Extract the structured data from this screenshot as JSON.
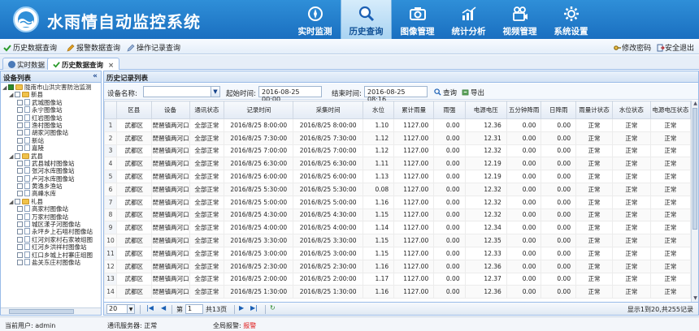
{
  "app": {
    "title": "水雨情自动监控系统"
  },
  "nav": [
    {
      "label": "实时监测",
      "icon": "compass-icon"
    },
    {
      "label": "历史查询",
      "icon": "magnifier-icon",
      "active": true
    },
    {
      "label": "图像管理",
      "icon": "camera-icon"
    },
    {
      "label": "统计分析",
      "icon": "bar-chart-icon"
    },
    {
      "label": "视频管理",
      "icon": "video-icon"
    },
    {
      "label": "系统设置",
      "icon": "gear-icon"
    }
  ],
  "toolbar": {
    "history_query": "历史数据查询",
    "alarm_query": "报警数据查询",
    "operation_query": "操作记录查询",
    "change_password": "修改密码",
    "safe_exit": "安全退出"
  },
  "tabs": [
    {
      "label": "实时数据"
    },
    {
      "label": "历史数据查询",
      "active": true,
      "closable": "×"
    }
  ],
  "sidebar": {
    "title": "设备列表",
    "collapse": "«",
    "tree": [
      {
        "level": 0,
        "type": "root",
        "label": "陇南市山洪灾害防治监测"
      },
      {
        "level": 1,
        "type": "folder",
        "label": "新县"
      },
      {
        "level": 2,
        "type": "leaf",
        "label": "武城图像站"
      },
      {
        "level": 2,
        "type": "leaf",
        "label": "永宁图像站"
      },
      {
        "level": 2,
        "type": "leaf",
        "label": "红岩图像站"
      },
      {
        "level": 2,
        "type": "leaf",
        "label": "渔村图像站"
      },
      {
        "level": 2,
        "type": "leaf",
        "label": "胡家河图像站"
      },
      {
        "level": 2,
        "type": "leaf",
        "label": "新站"
      },
      {
        "level": 2,
        "type": "leaf",
        "label": "嘉陵"
      },
      {
        "level": 1,
        "type": "folder",
        "label": "武县"
      },
      {
        "level": 2,
        "type": "leaf",
        "label": "武县城村图像站"
      },
      {
        "level": 2,
        "type": "leaf",
        "label": "张河水库图像站"
      },
      {
        "level": 2,
        "type": "leaf",
        "label": "卢河水库图像站"
      },
      {
        "level": 2,
        "type": "leaf",
        "label": "黄逸乡渔站"
      },
      {
        "level": 2,
        "type": "leaf",
        "label": "高峰水库"
      },
      {
        "level": 1,
        "type": "folder",
        "label": "礼县"
      },
      {
        "level": 2,
        "type": "leaf",
        "label": "高家村图像站"
      },
      {
        "level": 2,
        "type": "leaf",
        "label": "万家村图像站"
      },
      {
        "level": 2,
        "type": "leaf",
        "label": "城区漾子河图像站"
      },
      {
        "level": 2,
        "type": "leaf",
        "label": "永坪乡上石咀村图像站"
      },
      {
        "level": 2,
        "type": "leaf",
        "label": "红河刘家村石家坡组图"
      },
      {
        "level": 2,
        "type": "leaf",
        "label": "红河乡洪祥村图像站"
      },
      {
        "level": 2,
        "type": "leaf",
        "label": "红口乡城上村寨庄组图"
      },
      {
        "level": 2,
        "type": "leaf",
        "label": "盐关东庄村图像站"
      }
    ]
  },
  "records": {
    "title": "历史记录列表",
    "device_label": "设备名称:",
    "device_value": "",
    "start_label": "起始时间:",
    "start_value": "2016-08-25 00:00",
    "end_label": "结束时间:",
    "end_value": "2016-08-25 08:16",
    "query_label": "查询",
    "export_label": "导出",
    "columns": [
      "",
      "区县",
      "设备",
      "通讯状态",
      "记录时间",
      "采集时间",
      "水位",
      "累计雨量",
      "雨强",
      "电源电压",
      "五分钟降雨",
      "日降雨",
      "雨量计状态",
      "水位状态",
      "电源电压状态"
    ],
    "rows": [
      [
        "1",
        "武都区",
        "琵琶镇两河口",
        "全部正常",
        "2016/8/25 8:00:00",
        "2016/8/25 8:00:00",
        "1.10",
        "1127.00",
        "0.00",
        "12.36",
        "0.00",
        "0.00",
        "正常",
        "正常",
        "正常"
      ],
      [
        "2",
        "武都区",
        "琵琶镇两河口",
        "全部正常",
        "2016/8/25 7:30:00",
        "2016/8/25 7:30:00",
        "1.12",
        "1127.00",
        "0.00",
        "12.31",
        "0.00",
        "0.00",
        "正常",
        "正常",
        "正常"
      ],
      [
        "3",
        "武都区",
        "琵琶镇两河口",
        "全部正常",
        "2016/8/25 7:00:00",
        "2016/8/25 7:00:00",
        "1.12",
        "1127.00",
        "0.00",
        "12.32",
        "0.00",
        "0.00",
        "正常",
        "正常",
        "正常"
      ],
      [
        "4",
        "武都区",
        "琵琶镇两河口",
        "全部正常",
        "2016/8/25 6:30:00",
        "2016/8/25 6:30:00",
        "1.11",
        "1127.00",
        "0.00",
        "12.19",
        "0.00",
        "0.00",
        "正常",
        "正常",
        "正常"
      ],
      [
        "5",
        "武都区",
        "琵琶镇两河口",
        "全部正常",
        "2016/8/25 6:00:00",
        "2016/8/25 6:00:00",
        "1.13",
        "1127.00",
        "0.00",
        "12.19",
        "0.00",
        "0.00",
        "正常",
        "正常",
        "正常"
      ],
      [
        "6",
        "武都区",
        "琵琶镇两河口",
        "全部正常",
        "2016/8/25 5:30:00",
        "2016/8/25 5:30:00",
        "0.08",
        "1127.00",
        "0.00",
        "12.32",
        "0.00",
        "0.00",
        "正常",
        "正常",
        "正常"
      ],
      [
        "7",
        "武都区",
        "琵琶镇两河口",
        "全部正常",
        "2016/8/25 5:00:00",
        "2016/8/25 5:00:00",
        "1.16",
        "1127.00",
        "0.00",
        "12.32",
        "0.00",
        "0.00",
        "正常",
        "正常",
        "正常"
      ],
      [
        "8",
        "武都区",
        "琵琶镇两河口",
        "全部正常",
        "2016/8/25 4:30:00",
        "2016/8/25 4:30:00",
        "1.15",
        "1127.00",
        "0.00",
        "12.32",
        "0.00",
        "0.00",
        "正常",
        "正常",
        "正常"
      ],
      [
        "9",
        "武都区",
        "琵琶镇两河口",
        "全部正常",
        "2016/8/25 4:00:00",
        "2016/8/25 4:00:00",
        "1.14",
        "1127.00",
        "0.00",
        "12.34",
        "0.00",
        "0.00",
        "正常",
        "正常",
        "正常"
      ],
      [
        "10",
        "武都区",
        "琵琶镇两河口",
        "全部正常",
        "2016/8/25 3:30:00",
        "2016/8/25 3:30:00",
        "1.15",
        "1127.00",
        "0.00",
        "12.35",
        "0.00",
        "0.00",
        "正常",
        "正常",
        "正常"
      ],
      [
        "11",
        "武都区",
        "琵琶镇两河口",
        "全部正常",
        "2016/8/25 3:00:00",
        "2016/8/25 3:00:00",
        "1.15",
        "1127.00",
        "0.00",
        "12.33",
        "0.00",
        "0.00",
        "正常",
        "正常",
        "正常"
      ],
      [
        "12",
        "武都区",
        "琵琶镇两河口",
        "全部正常",
        "2016/8/25 2:30:00",
        "2016/8/25 2:30:00",
        "1.16",
        "1127.00",
        "0.00",
        "12.36",
        "0.00",
        "0.00",
        "正常",
        "正常",
        "正常"
      ],
      [
        "13",
        "武都区",
        "琵琶镇两河口",
        "全部正常",
        "2016/8/25 2:00:00",
        "2016/8/25 2:00:00",
        "1.17",
        "1127.00",
        "0.00",
        "12.37",
        "0.00",
        "0.00",
        "正常",
        "正常",
        "正常"
      ],
      [
        "14",
        "武都区",
        "琵琶镇两河口",
        "全部正常",
        "2016/8/25 1:30:00",
        "2016/8/25 1:30:00",
        "1.16",
        "1127.00",
        "0.00",
        "12.36",
        "0.00",
        "0.00",
        "正常",
        "正常",
        "正常"
      ]
    ]
  },
  "pager": {
    "page_size": "20",
    "first": "|◀",
    "prev": "◀",
    "page_prefix": "第",
    "page_value": "1",
    "page_suffix": "共13页",
    "next": "▶",
    "last": "▶|",
    "refresh": "↻",
    "summary": "显示1到20,共255记录"
  },
  "status": {
    "user_label": "当前用户:",
    "user_value": "admin",
    "server_label": "通讯服务器:",
    "server_value": "正常",
    "alarm_label": "全局报警:",
    "alarm_value": "报警"
  },
  "colors": {
    "header": "#1a6fc0",
    "panel_border": "#99bbe8",
    "alarm": "#e02020"
  }
}
